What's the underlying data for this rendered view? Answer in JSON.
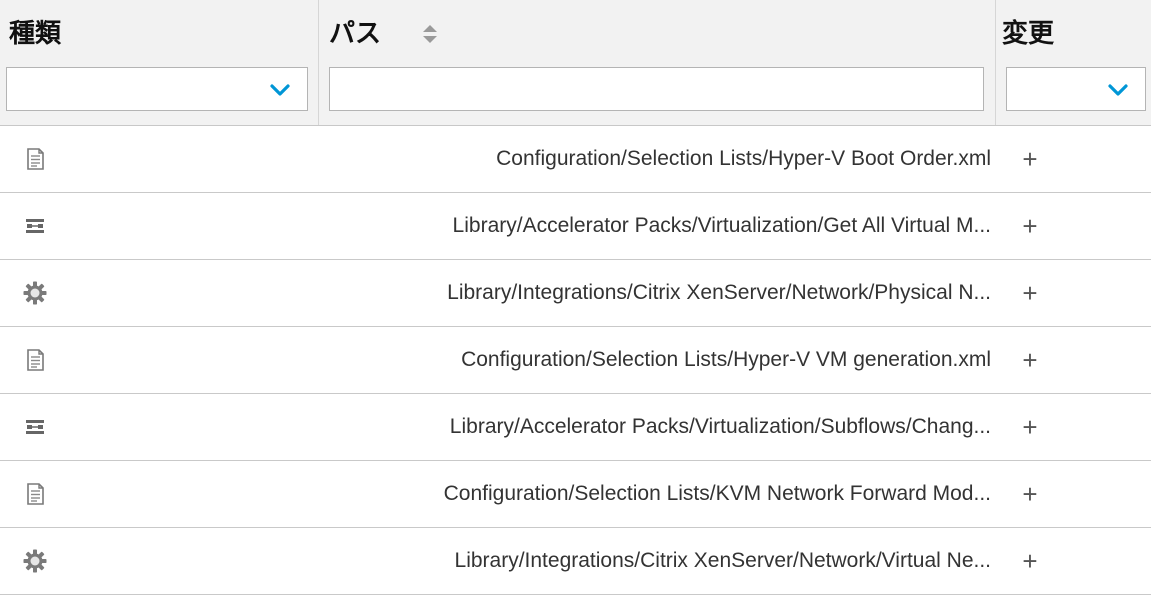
{
  "header": {
    "columns": {
      "type": {
        "title": "種類",
        "filter_value": ""
      },
      "path": {
        "title": "パス",
        "filter_value": ""
      },
      "change": {
        "title": "変更",
        "filter_value": ""
      }
    },
    "sort_icon": "sort-up-down-icon",
    "accent_color": "#0096d6"
  },
  "rows": [
    {
      "icon": "document-icon",
      "path": "Configuration/Selection Lists/Hyper-V Boot Order.xml",
      "change": "+"
    },
    {
      "icon": "flow-icon",
      "path": "Library/Accelerator Packs/Virtualization/Get All Virtual M...",
      "change": "+"
    },
    {
      "icon": "gear-icon",
      "path": "Library/Integrations/Citrix XenServer/Network/Physical N...",
      "change": "+"
    },
    {
      "icon": "document-icon",
      "path": "Configuration/Selection Lists/Hyper-V VM generation.xml",
      "change": "+"
    },
    {
      "icon": "flow-icon",
      "path": "Library/Accelerator Packs/Virtualization/Subflows/Chang...",
      "change": "+"
    },
    {
      "icon": "document-icon",
      "path": "Configuration/Selection Lists/KVM Network Forward Mod...",
      "change": "+"
    },
    {
      "icon": "gear-icon",
      "path": "Library/Integrations/Citrix XenServer/Network/Virtual Ne...",
      "change": "+"
    }
  ]
}
